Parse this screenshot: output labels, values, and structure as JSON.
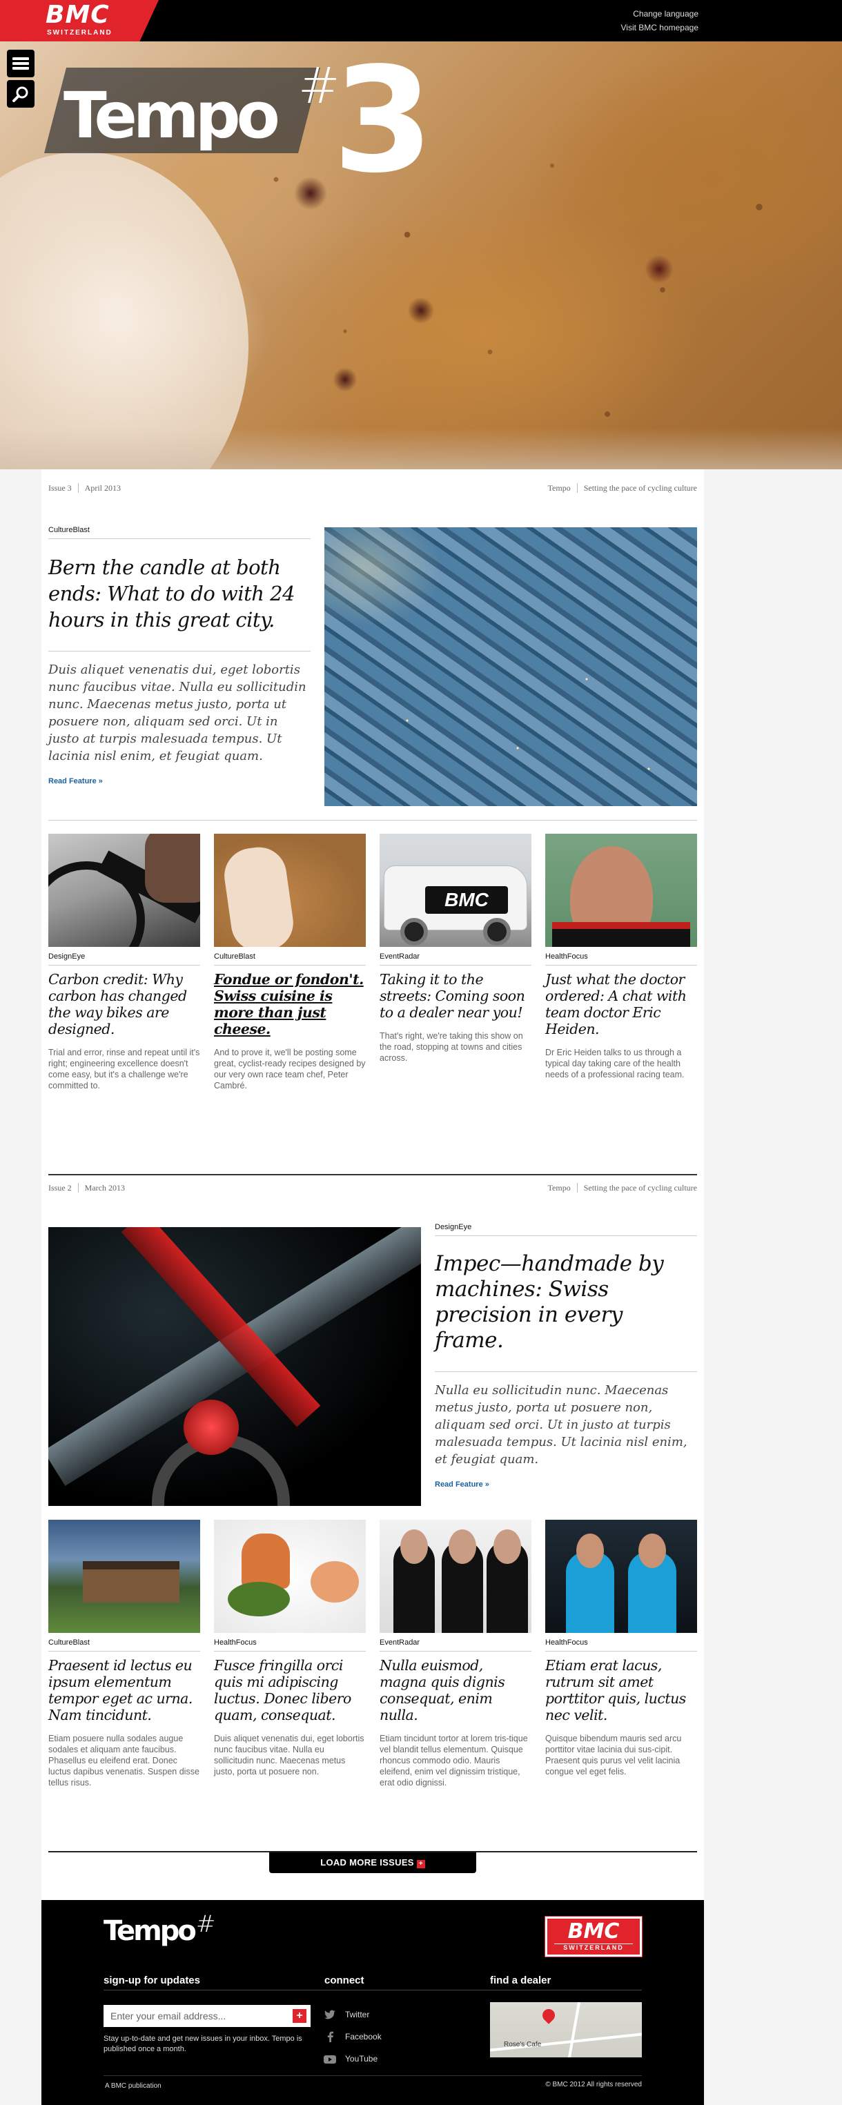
{
  "header": {
    "logo_wordmark": "BMC",
    "logo_country": "SWITZERLAND",
    "links": [
      "Change language",
      "Visit BMC homepage"
    ]
  },
  "hero": {
    "title": "Tempo",
    "hash": "#",
    "issue_number": "3",
    "menu_icon": "hamburger-icon",
    "search_icon": "search-icon"
  },
  "issue3": {
    "issue_label": "Issue 3",
    "date": "April 2013",
    "brand": "Tempo",
    "tagline": "Setting the pace of cycling culture",
    "feature": {
      "category": "CultureBlast",
      "headline": "Bern the candle at both ends: What to do with 24 hours in this great city.",
      "dek": "Duis aliquet venenatis dui, eget lobortis nunc faucibus vitae. Nulla eu sollicitudin nunc. Maecenas metus justo, porta ut posuere non, aliquam sed orci. Ut in justo at turpis malesuada tempus. Ut lacinia nisl enim, et feugiat quam.",
      "read_more": "Read Feature »"
    },
    "cards": [
      {
        "category": "DesignEye",
        "headline": "Carbon credit: Why carbon has changed the way bikes are designed.",
        "body": "Trial and error, rinse and repeat until it's right; engineering excellence doesn't come easy, but it's a challenge we're committed to."
      },
      {
        "category": "CultureBlast",
        "headline": "Fondue or fondon't. Swiss cuisine is more than just cheese.",
        "body": "And to prove it, we'll be posting some great, cyclist-ready recipes designed by our very own race team chef, Peter Cambré."
      },
      {
        "category": "EventRadar",
        "headline": "Taking it to the streets: Coming soon to a dealer near you!",
        "body": "That's right, we're taking this show on the road, stopping at towns and cities across."
      },
      {
        "category": "HealthFocus",
        "headline": "Just what the doctor ordered: A chat with team doctor Eric Heiden.",
        "body": "Dr Eric Heiden talks to us through a typical day taking care of the health needs of a professional racing team."
      }
    ]
  },
  "issue2": {
    "issue_label": "Issue 2",
    "date": "March 2013",
    "brand": "Tempo",
    "tagline": "Setting the pace of cycling culture",
    "feature": {
      "category": "DesignEye",
      "headline": "Impec—handmade by machines: Swiss precision in every frame.",
      "dek": "Nulla eu sollicitudin nunc. Maecenas metus justo, porta ut posuere non, aliquam sed orci. Ut in justo at turpis malesuada tempus. Ut lacinia nisl enim, et feugiat quam.",
      "read_more": "Read Feature »"
    },
    "cards": [
      {
        "category": "CultureBlast",
        "headline": "Praesent id lectus eu ipsum elementum tempor eget ac urna. Nam tincidunt.",
        "body": "Etiam posuere nulla sodales augue sodales et aliquam ante faucibus. Phasellus eu eleifend erat. Donec luctus dapibus venenatis. Suspen disse tellus risus."
      },
      {
        "category": "HealthFocus",
        "headline": "Fusce fringilla orci quis mi adipiscing luctus. Donec libero quam, consequat.",
        "body": "Duis aliquet venenatis dui, eget lobortis nunc faucibus vitae. Nulla eu sollicitudin nunc. Maecenas metus justo, porta ut posuere non."
      },
      {
        "category": "EventRadar",
        "headline": "Nulla euismod, magna quis dignis consequat, enim nulla.",
        "body": "Etiam tincidunt tortor at lorem tris-tique vel blandit tellus elementum. Quisque rhoncus commodo odio. Mauris eleifend, enim vel dignissim tristique, erat odio dignissi."
      },
      {
        "category": "HealthFocus",
        "headline": "Etiam erat lacus, rutrum sit amet porttitor quis, luctus nec velit.",
        "body": "Quisque bibendum mauris sed arcu porttitor vitae lacinia dui sus-cipit. Praesent quis purus vel velit lacinia congue vel eget felis."
      }
    ]
  },
  "load_more": {
    "label": "LOAD MORE ISSUES",
    "plus": "+"
  },
  "footer": {
    "logo": "Tempo",
    "hash": "#",
    "bmc_wordmark": "BMC",
    "bmc_country": "SWITZERLAND",
    "signup_title": "sign-up for updates",
    "connect_title": "connect",
    "dealer_title": "find a dealer",
    "email_placeholder": "Enter your email address...",
    "email_submit": "+",
    "note": "Stay up-to-date and get new issues in your inbox. Tempo is published once a month.",
    "social": [
      "Twitter",
      "Facebook",
      "YouTube"
    ],
    "map_label": "Rose's Cafe",
    "left_text": "A BMC publication",
    "copyright": "© BMC 2012 All rights reserved"
  }
}
